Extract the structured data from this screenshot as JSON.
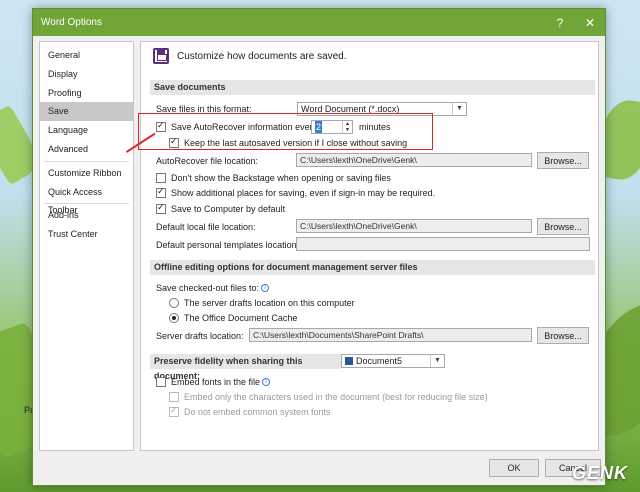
{
  "window": {
    "title": "Word Options",
    "help": "?",
    "close": "✕"
  },
  "sidebar": {
    "items": [
      "General",
      "Display",
      "Proofing",
      "Save",
      "Language",
      "Advanced",
      "Customize Ribbon",
      "Quick Access Toolbar",
      "Add-ins",
      "Trust Center"
    ],
    "active": "Save"
  },
  "header": {
    "text": "Customize how documents are saved."
  },
  "save_documents": {
    "section": "Save documents",
    "format_label": "Save files in this format:",
    "format_value": "Word Document (*.docx)",
    "autorecover_label": "Save AutoRecover information every",
    "autorecover_value": "2",
    "minutes": "minutes",
    "keep_last": "Keep the last autosaved version if I close without saving",
    "autorecover_loc_label": "AutoRecover file location:",
    "autorecover_loc_value": "C:\\Users\\lexth\\OneDrive\\Genk\\",
    "browse": "Browse...",
    "dont_show_backstage": "Don't show the Backstage when opening or saving files",
    "show_places": "Show additional places for saving, even if sign-in may be required.",
    "save_to_computer": "Save to Computer by default",
    "default_local_label": "Default local file location:",
    "default_local_value": "C:\\Users\\lexth\\OneDrive\\Genk\\",
    "default_templates_label": "Default personal templates location:",
    "default_templates_value": ""
  },
  "offline": {
    "section": "Offline editing options for document management server files",
    "checked_out_label": "Save checked-out files to:",
    "server_drafts_option": "The server drafts location on this computer",
    "office_cache_option": "The Office Document Cache",
    "server_drafts_label": "Server drafts location:",
    "server_drafts_value": "C:\\Users\\lexth\\Documents\\SharePoint Drafts\\",
    "browse": "Browse..."
  },
  "fidelity": {
    "section": "Preserve fidelity when sharing this document:",
    "document": "Document5",
    "embed_fonts": "Embed fonts in the file",
    "embed_only": "Embed only the characters used in the document (best for reducing file size)",
    "no_common": "Do not embed common system fonts"
  },
  "footer": {
    "ok": "OK",
    "cancel": "Cancel"
  },
  "background": {
    "snippet": "Pa",
    "watermark": "GENK"
  },
  "colors": {
    "titlebar": "#6fa637",
    "highlight": "#d9262c"
  }
}
